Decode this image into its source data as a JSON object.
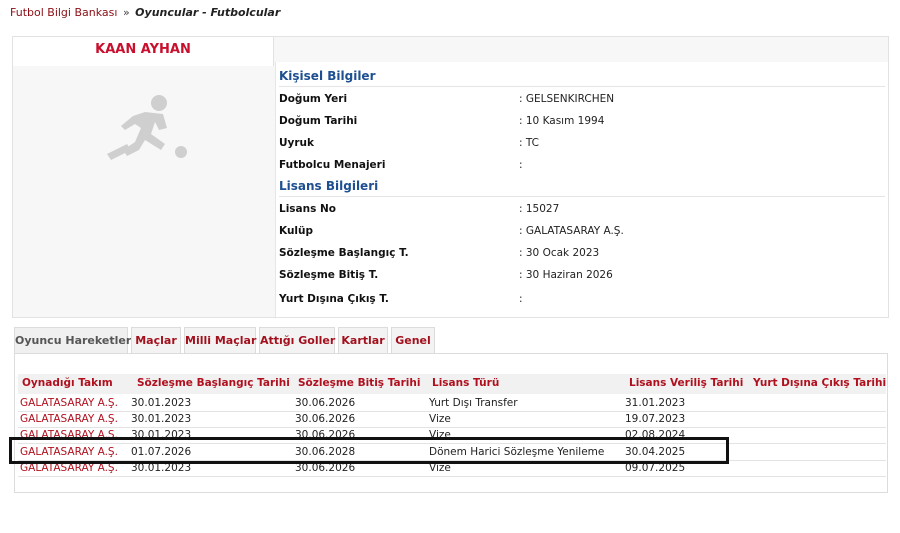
{
  "breadcrumb": {
    "root": "Futbol Bilgi Bankası",
    "separator": "»",
    "current": "Oyuncular - Futbolcular"
  },
  "player": {
    "name": "KAAN AYHAN"
  },
  "personal": {
    "title": "Kişisel Bilgiler",
    "rows": [
      {
        "label": "Doğum Yeri",
        "value": ":  GELSENKIRCHEN"
      },
      {
        "label": "Doğum Tarihi",
        "value": ":  10 Kasım 1994"
      },
      {
        "label": "Uyruk",
        "value": ":  TC"
      },
      {
        "label": "Futbolcu Menajeri",
        "value": ":"
      }
    ]
  },
  "license": {
    "title": "Lisans Bilgileri",
    "rows": [
      {
        "label": "Lisans No",
        "value": ": 15027"
      },
      {
        "label": "Kulüp",
        "value": ": GALATASARAY A.Ş."
      },
      {
        "label": "Sözleşme Başlangıç T.",
        "value": ": 30 Ocak 2023"
      },
      {
        "label": "Sözleşme Bitiş T.",
        "value": ": 30 Haziran 2026"
      },
      {
        "label": "Yurt Dışına Çıkış T.",
        "value": ":"
      }
    ]
  },
  "tabs": [
    {
      "label": "Oyuncu Hareketleri",
      "active": true
    },
    {
      "label": "Maçlar",
      "active": false
    },
    {
      "label": "Milli Maçlar",
      "active": false
    },
    {
      "label": "Attığı Goller",
      "active": false
    },
    {
      "label": "Kartlar",
      "active": false
    },
    {
      "label": "Genel",
      "active": false
    }
  ],
  "table": {
    "headers": [
      "Oynadığı Takım",
      "Sözleşme Başlangıç Tarihi",
      "Sözleşme Bitiş Tarihi",
      "Lisans Türü",
      "Lisans Veriliş Tarihi",
      "Yurt Dışına Çıkış Tarihi"
    ],
    "rows": [
      [
        "GALATASARAY A.Ş.",
        "30.01.2023",
        "30.06.2026",
        "Yurt Dışı Transfer",
        "31.01.2023",
        ""
      ],
      [
        "GALATASARAY A.Ş.",
        "30.01.2023",
        "30.06.2026",
        "Vize",
        "19.07.2023",
        ""
      ],
      [
        "GALATASARAY A.Ş.",
        "30.01.2023",
        "30.06.2026",
        "Vize",
        "02.08.2024",
        ""
      ],
      [
        "GALATASARAY A.Ş.",
        "01.07.2026",
        "30.06.2028",
        "Dönem Harici Sözleşme Yenileme",
        "30.04.2025",
        ""
      ],
      [
        "GALATASARAY A.Ş.",
        "30.01.2023",
        "30.06.2026",
        "Vize",
        "09.07.2025",
        ""
      ]
    ]
  },
  "icons": {
    "player_photo": "footballer-silhouette-icon"
  },
  "colors": {
    "brand_red": "#a3101d",
    "section_blue": "#1d4f91"
  }
}
